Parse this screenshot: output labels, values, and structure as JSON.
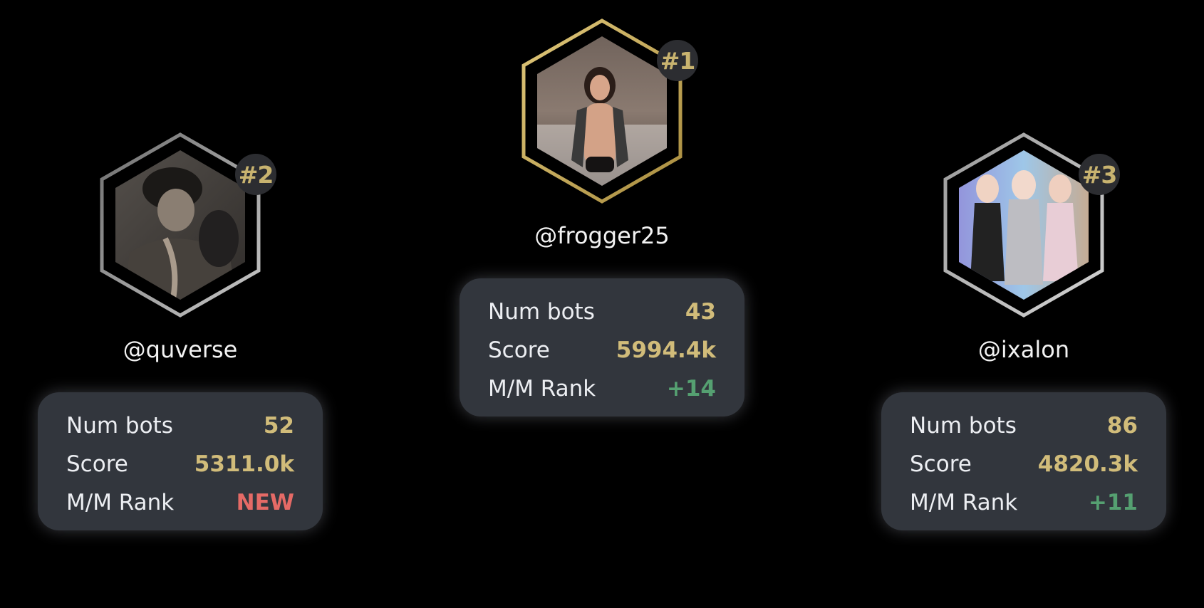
{
  "leaderboard": [
    {
      "slot": "rank1",
      "rank": "#1",
      "username": "@frogger25",
      "frame_color": "#c9b063",
      "num_bots_label": "Num bots",
      "num_bots": "43",
      "score_label": "Score",
      "score": "5994.4k",
      "mm_label": "M/M Rank",
      "mm_rank": "+14",
      "mm_status": "up"
    },
    {
      "slot": "rank2",
      "rank": "#2",
      "username": "@quverse",
      "frame_color": "#9a9a9a",
      "num_bots_label": "Num bots",
      "num_bots": "52",
      "score_label": "Score",
      "score": "5311.0k",
      "mm_label": "M/M Rank",
      "mm_rank": "NEW",
      "mm_status": "new"
    },
    {
      "slot": "rank3",
      "rank": "#3",
      "username": "@ixalon",
      "frame_color": "#b4b4b4",
      "num_bots_label": "Num bots",
      "num_bots": "86",
      "score_label": "Score",
      "score": "4820.3k",
      "mm_label": "M/M Rank",
      "mm_rank": "+11",
      "mm_status": "up"
    }
  ],
  "colors": {
    "background": "#000000",
    "card": "#32363d",
    "value_gold": "#d1bc7a",
    "value_green": "#55a071",
    "value_red": "#e56a66",
    "badge_bg": "#2c2d31"
  }
}
